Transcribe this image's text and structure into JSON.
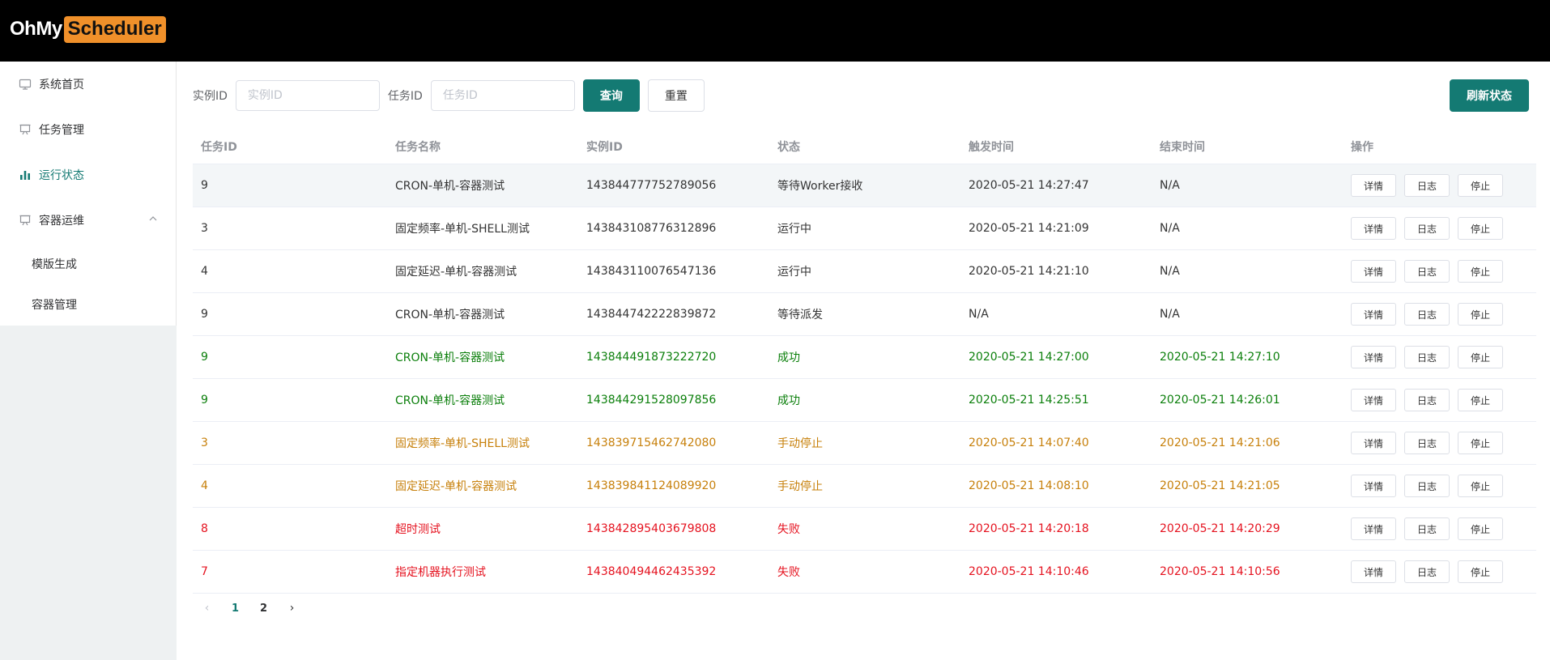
{
  "header": {
    "logo_prefix": "OhMy",
    "logo_highlight": "Scheduler",
    "logo_highlight_color": "#f0902a"
  },
  "sidebar": {
    "items": [
      {
        "label": "系统首页",
        "icon": "monitor-icon"
      },
      {
        "label": "任务管理",
        "icon": "presentation-icon"
      },
      {
        "label": "运行状态",
        "icon": "bar-chart-icon"
      },
      {
        "label": "容器运维",
        "icon": "presentation-icon"
      }
    ],
    "active_index": 2,
    "submenu": [
      {
        "label": "模版生成"
      },
      {
        "label": "容器管理"
      }
    ],
    "submenu_toggle_icon": "chevron-up-icon"
  },
  "search": {
    "instance_label": "实例ID",
    "instance_placeholder": "实例ID",
    "instance_value": "",
    "job_label": "任务ID",
    "job_placeholder": "任务ID",
    "job_value": "",
    "query_button": "查询",
    "reset_button": "重置",
    "refresh_button": "刷新状态"
  },
  "table": {
    "columns": [
      "任务ID",
      "任务名称",
      "实例ID",
      "状态",
      "触发时间",
      "结束时间",
      "操作"
    ],
    "actions": [
      "详情",
      "日志",
      "停止"
    ],
    "status_colors": {
      "default": "#333333",
      "success": "#0b7f0b",
      "stopped": "#c7800b",
      "failed": "#e5121f"
    },
    "rows": [
      {
        "job_id": "9",
        "job_name": "CRON-单机-容器测试",
        "instance_id": "143844777752789056",
        "status": "等待Worker接收",
        "trigger_time": "2020-05-21 14:27:47",
        "finish_time": "N/A",
        "tone": "default"
      },
      {
        "job_id": "3",
        "job_name": "固定频率-单机-SHELL测试",
        "instance_id": "143843108776312896",
        "status": "运行中",
        "trigger_time": "2020-05-21 14:21:09",
        "finish_time": "N/A",
        "tone": "default"
      },
      {
        "job_id": "4",
        "job_name": "固定延迟-单机-容器测试",
        "instance_id": "143843110076547136",
        "status": "运行中",
        "trigger_time": "2020-05-21 14:21:10",
        "finish_time": "N/A",
        "tone": "default"
      },
      {
        "job_id": "9",
        "job_name": "CRON-单机-容器测试",
        "instance_id": "143844742222839872",
        "status": "等待派发",
        "trigger_time": "N/A",
        "finish_time": "N/A",
        "tone": "default"
      },
      {
        "job_id": "9",
        "job_name": "CRON-单机-容器测试",
        "instance_id": "143844491873222720",
        "status": "成功",
        "trigger_time": "2020-05-21 14:27:00",
        "finish_time": "2020-05-21 14:27:10",
        "tone": "success"
      },
      {
        "job_id": "9",
        "job_name": "CRON-单机-容器测试",
        "instance_id": "143844291528097856",
        "status": "成功",
        "trigger_time": "2020-05-21 14:25:51",
        "finish_time": "2020-05-21 14:26:01",
        "tone": "success"
      },
      {
        "job_id": "3",
        "job_name": "固定频率-单机-SHELL测试",
        "instance_id": "143839715462742080",
        "status": "手动停止",
        "trigger_time": "2020-05-21 14:07:40",
        "finish_time": "2020-05-21 14:21:06",
        "tone": "stopped"
      },
      {
        "job_id": "4",
        "job_name": "固定延迟-单机-容器测试",
        "instance_id": "143839841124089920",
        "status": "手动停止",
        "trigger_time": "2020-05-21 14:08:10",
        "finish_time": "2020-05-21 14:21:05",
        "tone": "stopped"
      },
      {
        "job_id": "8",
        "job_name": "超时测试",
        "instance_id": "143842895403679808",
        "status": "失败",
        "trigger_time": "2020-05-21 14:20:18",
        "finish_time": "2020-05-21 14:20:29",
        "tone": "failed"
      },
      {
        "job_id": "7",
        "job_name": "指定机器执行测试",
        "instance_id": "143840494462435392",
        "status": "失败",
        "trigger_time": "2020-05-21 14:10:46",
        "finish_time": "2020-05-21 14:10:56",
        "tone": "failed"
      }
    ]
  },
  "pagination": {
    "pages": [
      "1",
      "2"
    ],
    "current": "1",
    "prev_icon": "chevron-left-icon",
    "next_icon": "chevron-right-icon"
  },
  "theme": {
    "accent": "#147a73"
  }
}
